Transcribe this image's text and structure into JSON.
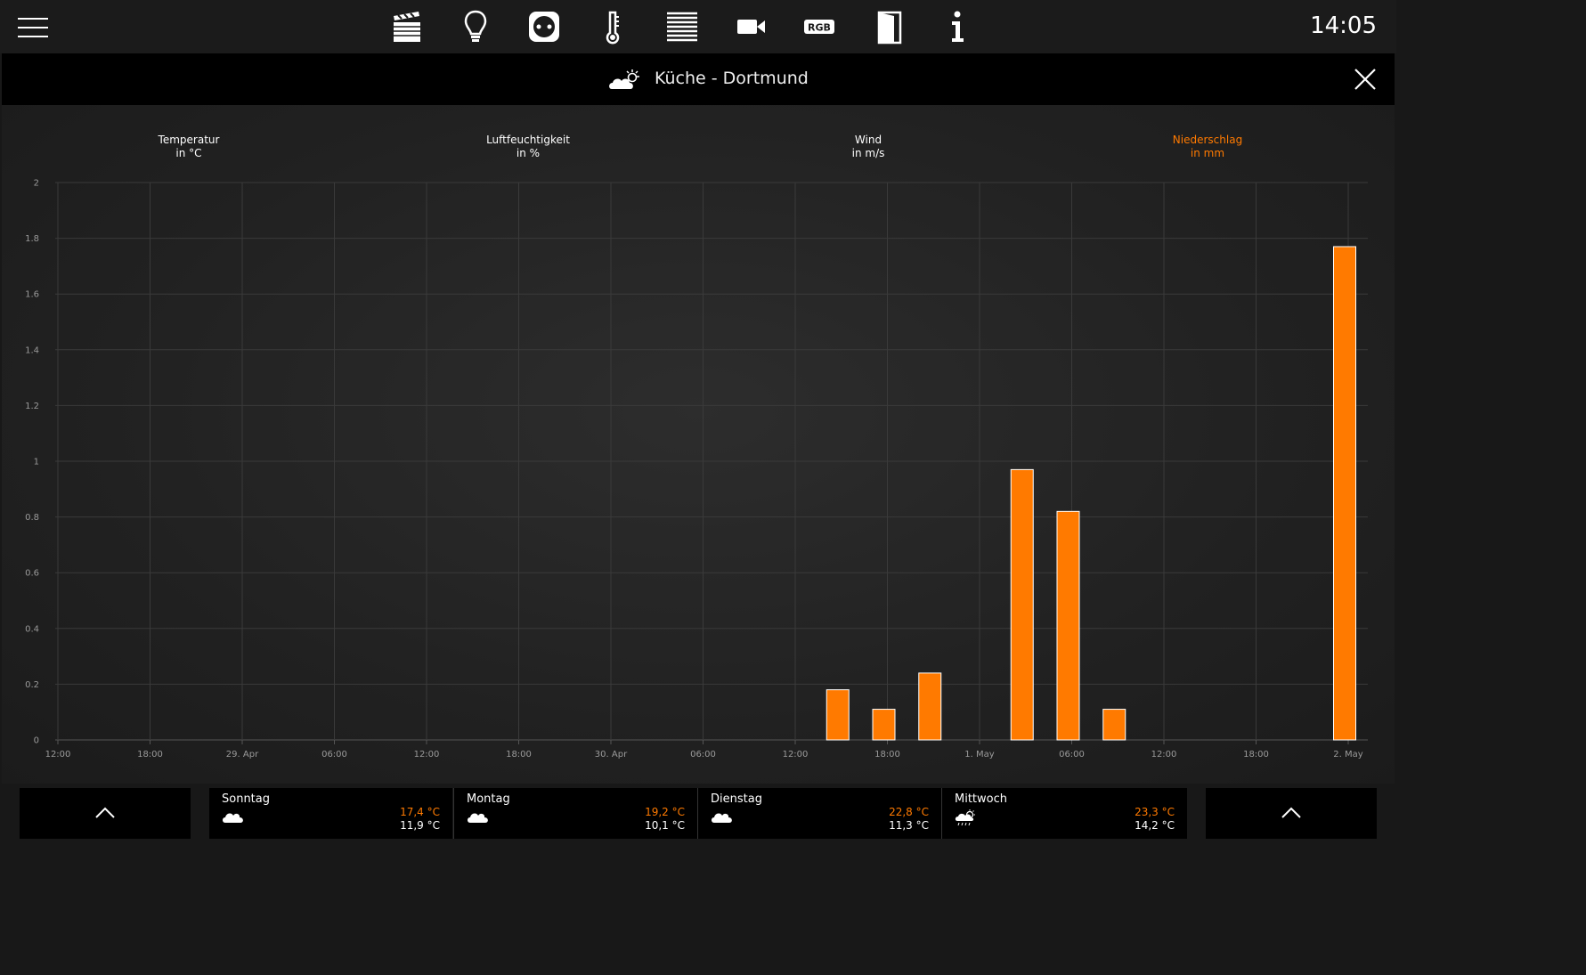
{
  "topbar": {
    "clock": "14:05",
    "nav_icons": [
      "scenes-icon",
      "light-bulb-icon",
      "socket-icon",
      "thermometer-icon",
      "blinds-icon",
      "camera-icon",
      "rgb-icon",
      "door-icon",
      "info-icon"
    ],
    "rgb_label": "RGB"
  },
  "header": {
    "title": "Küche - Dortmund",
    "weather_icon": "partly-cloudy-icon"
  },
  "tabs": [
    {
      "label": "Temperatur",
      "unit": "in °C",
      "active": false
    },
    {
      "label": "Luftfeuchtigkeit",
      "unit": "in %",
      "active": false
    },
    {
      "label": "Wind",
      "unit": "in m/s",
      "active": false
    },
    {
      "label": "Niederschlag",
      "unit": "in mm",
      "active": true
    }
  ],
  "colors": {
    "accent": "#ff7a00",
    "bar_stroke": "#ffffff"
  },
  "chart_data": {
    "type": "bar",
    "series_name": "Niederschlag",
    "x_tick_labels": [
      "12:00",
      "18:00",
      "29. Apr",
      "06:00",
      "12:00",
      "18:00",
      "30. Apr",
      "06:00",
      "12:00",
      "18:00",
      "1. May",
      "06:00",
      "12:00",
      "18:00",
      "2. May"
    ],
    "y_tick_labels": [
      "0",
      "0.2",
      "0.4",
      "0.6",
      "0.8",
      "1",
      "1.2",
      "1.4",
      "1.6",
      "1.8",
      "2"
    ],
    "ylim": [
      0,
      2
    ],
    "bars": [
      {
        "hours": 51,
        "value": 0.18
      },
      {
        "hours": 54,
        "value": 0.11
      },
      {
        "hours": 57,
        "value": 0.24
      },
      {
        "hours": 63,
        "value": 0.97
      },
      {
        "hours": 66,
        "value": 0.82
      },
      {
        "hours": 69,
        "value": 0.11
      },
      {
        "hours": 84,
        "value": 1.77
      }
    ],
    "grid": true
  },
  "forecast": [
    {
      "day": "Sonntag",
      "icon": "cloudy-icon",
      "max": "17,4 °C",
      "min": "11,9 °C"
    },
    {
      "day": "Montag",
      "icon": "cloudy-icon",
      "max": "19,2 °C",
      "min": "10,1 °C"
    },
    {
      "day": "Dienstag",
      "icon": "cloudy-icon",
      "max": "22,8 °C",
      "min": "11,3 °C"
    },
    {
      "day": "Mittwoch",
      "icon": "rain-icon",
      "max": "23,3 °C",
      "min": "14,2 °C"
    }
  ]
}
